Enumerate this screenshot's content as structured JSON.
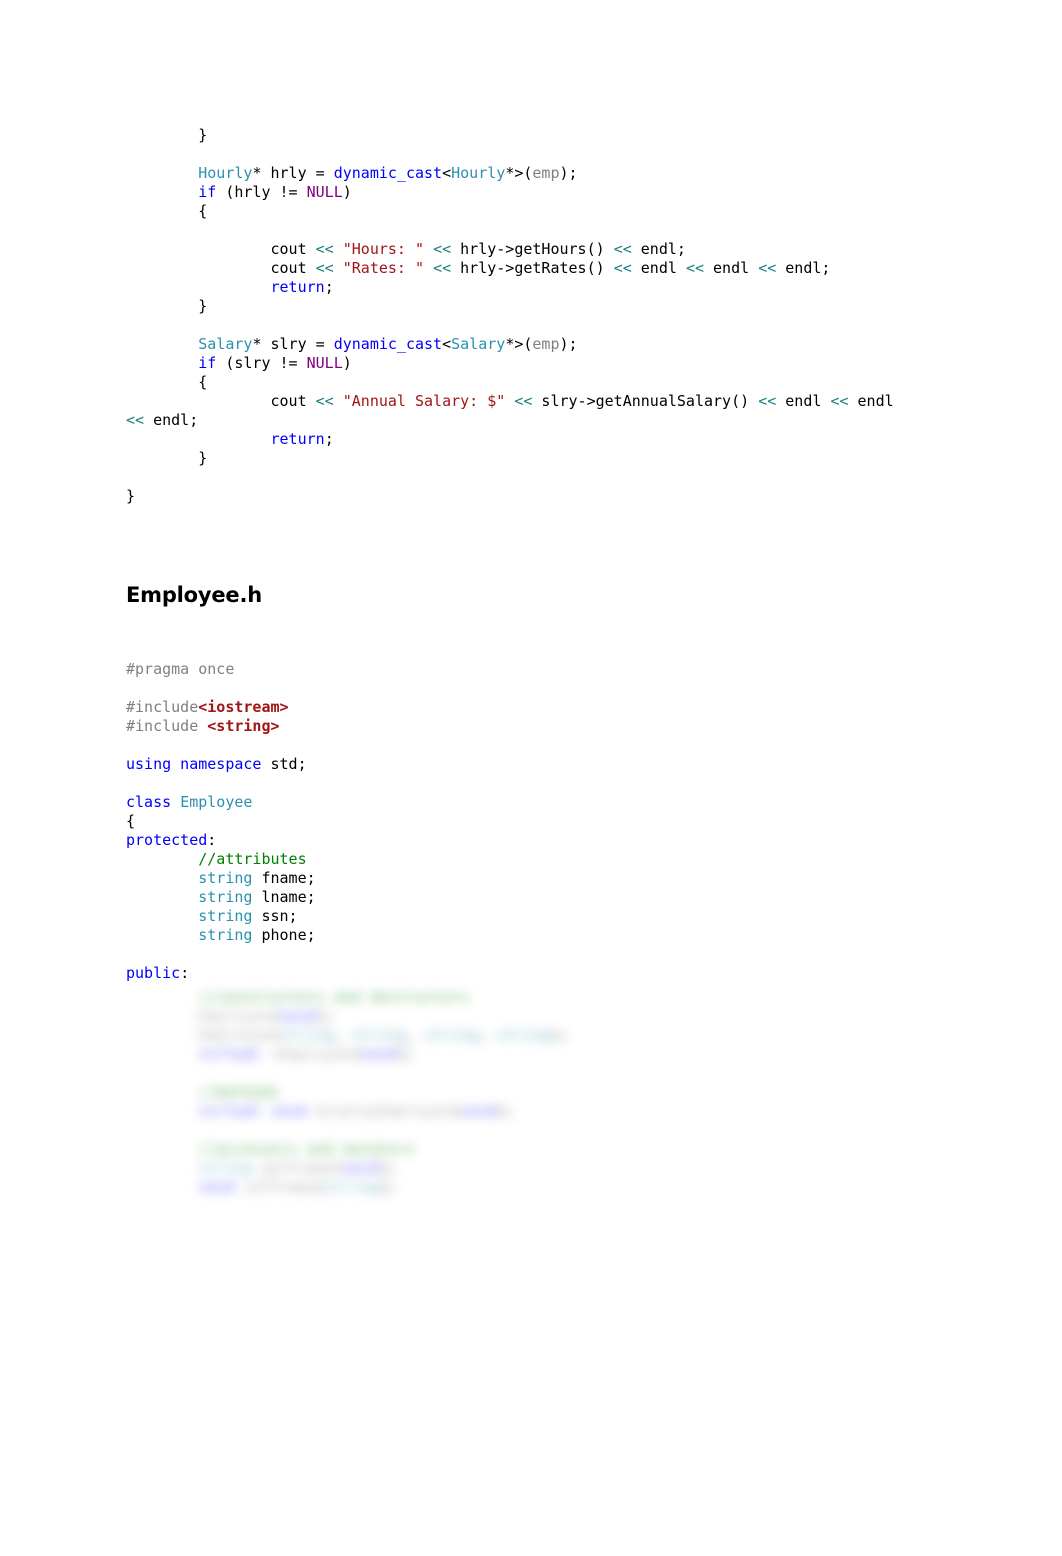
{
  "document": {
    "type": "source-code-listing",
    "language": "C++",
    "background_color": "#ffffff"
  },
  "palette": {
    "keyword": "#0000ff",
    "type_name": "#2b91af",
    "string": "#a31515",
    "operator": "#1a8080",
    "identifier_gray": "#808080",
    "preprocessor_target": "#a31515",
    "comment": "#008000",
    "constant": "#800080",
    "plain": "#000000"
  },
  "code_top": {
    "lines": [
      [
        {
          "t": "        }",
          "c": "plain"
        }
      ],
      [
        {
          "t": "",
          "c": "plain"
        }
      ],
      [
        {
          "t": "        ",
          "c": "plain"
        },
        {
          "t": "Hourly",
          "c": "type"
        },
        {
          "t": "* hrly = ",
          "c": "plain"
        },
        {
          "t": "dynamic_cast",
          "c": "kw"
        },
        {
          "t": "<",
          "c": "plain"
        },
        {
          "t": "Hourly",
          "c": "type"
        },
        {
          "t": "*>(",
          "c": "plain"
        },
        {
          "t": "emp",
          "c": "gray"
        },
        {
          "t": ");",
          "c": "plain"
        }
      ],
      [
        {
          "t": "        ",
          "c": "plain"
        },
        {
          "t": "if",
          "c": "kw"
        },
        {
          "t": " (hrly != ",
          "c": "plain"
        },
        {
          "t": "NULL",
          "c": "const"
        },
        {
          "t": ")",
          "c": "plain"
        }
      ],
      [
        {
          "t": "        {",
          "c": "plain"
        }
      ],
      [
        {
          "t": "",
          "c": "plain"
        }
      ],
      [
        {
          "t": "                cout ",
          "c": "plain"
        },
        {
          "t": "<<",
          "c": "op"
        },
        {
          "t": " ",
          "c": "plain"
        },
        {
          "t": "\"Hours: \"",
          "c": "str"
        },
        {
          "t": " ",
          "c": "plain"
        },
        {
          "t": "<<",
          "c": "op"
        },
        {
          "t": " hrly->getHours() ",
          "c": "plain"
        },
        {
          "t": "<<",
          "c": "op"
        },
        {
          "t": " endl;",
          "c": "plain"
        }
      ],
      [
        {
          "t": "                cout ",
          "c": "plain"
        },
        {
          "t": "<<",
          "c": "op"
        },
        {
          "t": " ",
          "c": "plain"
        },
        {
          "t": "\"Rates: \"",
          "c": "str"
        },
        {
          "t": " ",
          "c": "plain"
        },
        {
          "t": "<<",
          "c": "op"
        },
        {
          "t": " hrly->getRates() ",
          "c": "plain"
        },
        {
          "t": "<<",
          "c": "op"
        },
        {
          "t": " endl ",
          "c": "plain"
        },
        {
          "t": "<<",
          "c": "op"
        },
        {
          "t": " endl ",
          "c": "plain"
        },
        {
          "t": "<<",
          "c": "op"
        },
        {
          "t": " endl;",
          "c": "plain"
        }
      ],
      [
        {
          "t": "                ",
          "c": "plain"
        },
        {
          "t": "return",
          "c": "kw"
        },
        {
          "t": ";",
          "c": "plain"
        }
      ],
      [
        {
          "t": "        }",
          "c": "plain"
        }
      ],
      [
        {
          "t": "",
          "c": "plain"
        }
      ],
      [
        {
          "t": "        ",
          "c": "plain"
        },
        {
          "t": "Salary",
          "c": "type"
        },
        {
          "t": "* slry = ",
          "c": "plain"
        },
        {
          "t": "dynamic_cast",
          "c": "kw"
        },
        {
          "t": "<",
          "c": "plain"
        },
        {
          "t": "Salary",
          "c": "type"
        },
        {
          "t": "*>(",
          "c": "plain"
        },
        {
          "t": "emp",
          "c": "gray"
        },
        {
          "t": ");",
          "c": "plain"
        }
      ],
      [
        {
          "t": "        ",
          "c": "plain"
        },
        {
          "t": "if",
          "c": "kw"
        },
        {
          "t": " (slry != ",
          "c": "plain"
        },
        {
          "t": "NULL",
          "c": "const"
        },
        {
          "t": ")",
          "c": "plain"
        }
      ],
      [
        {
          "t": "        {",
          "c": "plain"
        }
      ],
      [
        {
          "t": "                cout ",
          "c": "plain"
        },
        {
          "t": "<<",
          "c": "op"
        },
        {
          "t": " ",
          "c": "plain"
        },
        {
          "t": "\"Annual Salary: $\"",
          "c": "str"
        },
        {
          "t": " ",
          "c": "plain"
        },
        {
          "t": "<<",
          "c": "op"
        },
        {
          "t": " slry->getAnnualSalary() ",
          "c": "plain"
        },
        {
          "t": "<<",
          "c": "op"
        },
        {
          "t": " endl ",
          "c": "plain"
        },
        {
          "t": "<<",
          "c": "op"
        },
        {
          "t": " endl",
          "c": "plain"
        }
      ],
      [
        {
          "t": "<<",
          "c": "op"
        },
        {
          "t": " endl;",
          "c": "plain"
        }
      ],
      [
        {
          "t": "                ",
          "c": "plain"
        },
        {
          "t": "return",
          "c": "kw"
        },
        {
          "t": ";",
          "c": "plain"
        }
      ],
      [
        {
          "t": "        }",
          "c": "plain"
        }
      ],
      [
        {
          "t": "",
          "c": "plain"
        }
      ],
      [
        {
          "t": "}",
          "c": "plain"
        }
      ]
    ]
  },
  "section_heading": {
    "text": "Employee.h"
  },
  "code_bottom": {
    "lines": [
      [
        {
          "t": "#pragma once",
          "c": "gray"
        }
      ],
      [
        {
          "t": "",
          "c": "plain"
        }
      ],
      [
        {
          "t": "#include",
          "c": "gray"
        },
        {
          "t": "<iostream>",
          "c": "macro"
        }
      ],
      [
        {
          "t": "#include ",
          "c": "gray"
        },
        {
          "t": "<string>",
          "c": "macro"
        }
      ],
      [
        {
          "t": "",
          "c": "plain"
        }
      ],
      [
        {
          "t": "using namespace",
          "c": "kw"
        },
        {
          "t": " std;",
          "c": "plain"
        }
      ],
      [
        {
          "t": "",
          "c": "plain"
        }
      ],
      [
        {
          "t": "class",
          "c": "kw"
        },
        {
          "t": " ",
          "c": "plain"
        },
        {
          "t": "Employee",
          "c": "type"
        }
      ],
      [
        {
          "t": "{",
          "c": "plain"
        }
      ],
      [
        {
          "t": "protected",
          "c": "kw"
        },
        {
          "t": ":",
          "c": "plain"
        }
      ],
      [
        {
          "t": "        ",
          "c": "plain"
        },
        {
          "t": "//attributes",
          "c": "comment"
        }
      ],
      [
        {
          "t": "        ",
          "c": "plain"
        },
        {
          "t": "string",
          "c": "type"
        },
        {
          "t": " fname;",
          "c": "plain"
        }
      ],
      [
        {
          "t": "        ",
          "c": "plain"
        },
        {
          "t": "string",
          "c": "type"
        },
        {
          "t": " lname;",
          "c": "plain"
        }
      ],
      [
        {
          "t": "        ",
          "c": "plain"
        },
        {
          "t": "string",
          "c": "type"
        },
        {
          "t": " ssn;",
          "c": "plain"
        }
      ],
      [
        {
          "t": "        ",
          "c": "plain"
        },
        {
          "t": "string",
          "c": "type"
        },
        {
          "t": " phone;",
          "c": "plain"
        }
      ],
      [
        {
          "t": "",
          "c": "plain"
        }
      ],
      [
        {
          "t": "public",
          "c": "kw"
        },
        {
          "t": ":",
          "c": "plain"
        }
      ]
    ]
  },
  "redacted_block": {
    "note": "blurred/illegible code region",
    "lines": [
      [
        {
          "t": "        ",
          "c": "plain"
        },
        {
          "t": "//constructors and destructors",
          "c": "comment"
        }
      ],
      [
        {
          "t": "        ",
          "c": "plain"
        },
        {
          "t": "Employee",
          "c": "gray"
        },
        {
          "t": "(",
          "c": "plain"
        },
        {
          "t": "void",
          "c": "kw"
        },
        {
          "t": ");",
          "c": "plain"
        }
      ],
      [
        {
          "t": "        ",
          "c": "plain"
        },
        {
          "t": "Employee",
          "c": "gray"
        },
        {
          "t": "(",
          "c": "plain"
        },
        {
          "t": "string",
          "c": "type"
        },
        {
          "t": ", ",
          "c": "plain"
        },
        {
          "t": "string",
          "c": "type"
        },
        {
          "t": ", ",
          "c": "plain"
        },
        {
          "t": "string",
          "c": "type"
        },
        {
          "t": ", ",
          "c": "plain"
        },
        {
          "t": "string",
          "c": "type"
        },
        {
          "t": ");",
          "c": "plain"
        }
      ],
      [
        {
          "t": "        ",
          "c": "plain"
        },
        {
          "t": "virtual",
          "c": "kw"
        },
        {
          "t": " ~",
          "c": "plain"
        },
        {
          "t": "Employee",
          "c": "gray"
        },
        {
          "t": "(",
          "c": "plain"
        },
        {
          "t": "void",
          "c": "kw"
        },
        {
          "t": ");",
          "c": "plain"
        }
      ],
      [
        {
          "t": "",
          "c": "plain"
        }
      ],
      [
        {
          "t": "        ",
          "c": "plain"
        },
        {
          "t": "//methods",
          "c": "comment"
        }
      ],
      [
        {
          "t": "        ",
          "c": "plain"
        },
        {
          "t": "virtual",
          "c": "kw"
        },
        {
          "t": " ",
          "c": "plain"
        },
        {
          "t": "void",
          "c": "kw"
        },
        {
          "t": " ",
          "c": "plain"
        },
        {
          "t": "displayEmployee",
          "c": "gray"
        },
        {
          "t": "(",
          "c": "plain"
        },
        {
          "t": "void",
          "c": "kw"
        },
        {
          "t": ");",
          "c": "plain"
        }
      ],
      [
        {
          "t": "",
          "c": "plain"
        }
      ],
      [
        {
          "t": "        ",
          "c": "plain"
        },
        {
          "t": "//accessors and mutators",
          "c": "comment"
        }
      ],
      [
        {
          "t": "        ",
          "c": "plain"
        },
        {
          "t": "string",
          "c": "type"
        },
        {
          "t": " ",
          "c": "plain"
        },
        {
          "t": "getFname",
          "c": "gray"
        },
        {
          "t": "(",
          "c": "plain"
        },
        {
          "t": "void",
          "c": "kw"
        },
        {
          "t": ");",
          "c": "plain"
        }
      ],
      [
        {
          "t": "        ",
          "c": "plain"
        },
        {
          "t": "void",
          "c": "kw"
        },
        {
          "t": " ",
          "c": "plain"
        },
        {
          "t": "setFname",
          "c": "gray"
        },
        {
          "t": "(",
          "c": "plain"
        },
        {
          "t": "string",
          "c": "type"
        },
        {
          "t": ");",
          "c": "plain"
        }
      ]
    ]
  }
}
